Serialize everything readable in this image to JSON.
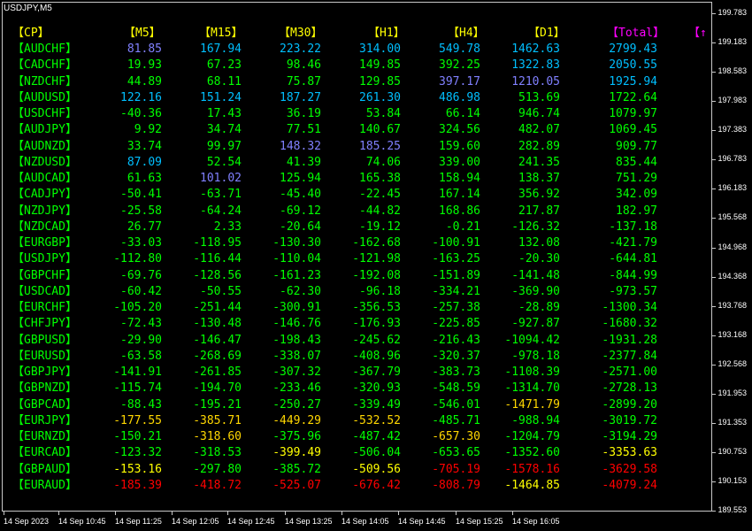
{
  "symbol_label": "USDJPY,M5",
  "headers": {
    "cp": "【CP】",
    "m5": "【M5】",
    "m15": "【M15】",
    "m30": "【M30】",
    "h1": "【H1】",
    "h4": "【H4】",
    "d1": "【D1】",
    "total": "【Total】",
    "extra": "【↑"
  },
  "colors": {
    "header": "#ffff00",
    "total_header": "#ff00ff",
    "pair": "#00ff00",
    "strong_positive": "#00bfff",
    "positive": "#00ff00",
    "neutral_purple": "#8080ff",
    "negative": "#00ff00",
    "warn": "#ffff00",
    "warn_orange": "#ffd700",
    "strong_negative": "#ff0000"
  },
  "rows": [
    {
      "pair": "【AUDCHF】",
      "m5": "81.85",
      "m15": "167.94",
      "m30": "223.22",
      "h1": "314.00",
      "h4": "549.78",
      "d1": "1462.63",
      "total": "2799.43",
      "c": [
        "#8080ff",
        "#00bfff",
        "#00bfff",
        "#00bfff",
        "#00bfff",
        "#00bfff",
        "#00bfff"
      ]
    },
    {
      "pair": "【CADCHF】",
      "m5": "19.93",
      "m15": "67.23",
      "m30": "98.46",
      "h1": "149.85",
      "h4": "392.25",
      "d1": "1322.83",
      "total": "2050.55",
      "c": [
        "#00ff00",
        "#00ff00",
        "#00ff00",
        "#00ff00",
        "#00ff00",
        "#00bfff",
        "#00bfff"
      ]
    },
    {
      "pair": "【NZDCHF】",
      "m5": "44.89",
      "m15": "68.11",
      "m30": "75.87",
      "h1": "129.85",
      "h4": "397.17",
      "d1": "1210.05",
      "total": "1925.94",
      "c": [
        "#00ff00",
        "#00ff00",
        "#00ff00",
        "#00ff00",
        "#8080ff",
        "#8080ff",
        "#00bfff"
      ]
    },
    {
      "pair": "【AUDUSD】",
      "m5": "122.16",
      "m15": "151.24",
      "m30": "187.27",
      "h1": "261.30",
      "h4": "486.98",
      "d1": "513.69",
      "total": "1722.64",
      "c": [
        "#00bfff",
        "#00bfff",
        "#00bfff",
        "#00bfff",
        "#00bfff",
        "#00ff00",
        "#00ff00"
      ]
    },
    {
      "pair": "【USDCHF】",
      "m5": "-40.36",
      "m15": "17.43",
      "m30": "36.19",
      "h1": "53.84",
      "h4": "66.14",
      "d1": "946.74",
      "total": "1079.97",
      "c": [
        "#00ff00",
        "#00ff00",
        "#00ff00",
        "#00ff00",
        "#00ff00",
        "#00ff00",
        "#00ff00"
      ]
    },
    {
      "pair": "【AUDJPY】",
      "m5": "9.92",
      "m15": "34.74",
      "m30": "77.51",
      "h1": "140.67",
      "h4": "324.56",
      "d1": "482.07",
      "total": "1069.45",
      "c": [
        "#00ff00",
        "#00ff00",
        "#00ff00",
        "#00ff00",
        "#00ff00",
        "#00ff00",
        "#00ff00"
      ]
    },
    {
      "pair": "【AUDNZD】",
      "m5": "33.74",
      "m15": "99.97",
      "m30": "148.32",
      "h1": "185.25",
      "h4": "159.60",
      "d1": "282.89",
      "total": "909.77",
      "c": [
        "#00ff00",
        "#00ff00",
        "#8080ff",
        "#8080ff",
        "#00ff00",
        "#00ff00",
        "#00ff00"
      ]
    },
    {
      "pair": "【NZDUSD】",
      "m5": "87.09",
      "m15": "52.54",
      "m30": "41.39",
      "h1": "74.06",
      "h4": "339.00",
      "d1": "241.35",
      "total": "835.44",
      "c": [
        "#00bfff",
        "#00ff00",
        "#00ff00",
        "#00ff00",
        "#00ff00",
        "#00ff00",
        "#00ff00"
      ]
    },
    {
      "pair": "【AUDCAD】",
      "m5": "61.63",
      "m15": "101.02",
      "m30": "125.94",
      "h1": "165.38",
      "h4": "158.94",
      "d1": "138.37",
      "total": "751.29",
      "c": [
        "#00ff00",
        "#8080ff",
        "#00ff00",
        "#00ff00",
        "#00ff00",
        "#00ff00",
        "#00ff00"
      ]
    },
    {
      "pair": "【CADJPY】",
      "m5": "-50.41",
      "m15": "-63.71",
      "m30": "-45.40",
      "h1": "-22.45",
      "h4": "167.14",
      "d1": "356.92",
      "total": "342.09",
      "c": [
        "#00ff00",
        "#00ff00",
        "#00ff00",
        "#00ff00",
        "#00ff00",
        "#00ff00",
        "#00ff00"
      ]
    },
    {
      "pair": "【NZDJPY】",
      "m5": "-25.58",
      "m15": "-64.24",
      "m30": "-69.12",
      "h1": "-44.82",
      "h4": "168.86",
      "d1": "217.87",
      "total": "182.97",
      "c": [
        "#00ff00",
        "#00ff00",
        "#00ff00",
        "#00ff00",
        "#00ff00",
        "#00ff00",
        "#00ff00"
      ]
    },
    {
      "pair": "【NZDCAD】",
      "m5": "26.77",
      "m15": "2.33",
      "m30": "-20.64",
      "h1": "-19.12",
      "h4": "-0.21",
      "d1": "-126.32",
      "total": "-137.18",
      "c": [
        "#00ff00",
        "#00ff00",
        "#00ff00",
        "#00ff00",
        "#00ff00",
        "#00ff00",
        "#00ff00"
      ]
    },
    {
      "pair": "【EURGBP】",
      "m5": "-33.03",
      "m15": "-118.95",
      "m30": "-130.30",
      "h1": "-162.68",
      "h4": "-100.91",
      "d1": "132.08",
      "total": "-421.79",
      "c": [
        "#00ff00",
        "#00ff00",
        "#00ff00",
        "#00ff00",
        "#00ff00",
        "#00ff00",
        "#00ff00"
      ]
    },
    {
      "pair": "【USDJPY】",
      "m5": "-112.80",
      "m15": "-116.44",
      "m30": "-110.04",
      "h1": "-121.98",
      "h4": "-163.25",
      "d1": "-20.30",
      "total": "-644.81",
      "c": [
        "#00ff00",
        "#00ff00",
        "#00ff00",
        "#00ff00",
        "#00ff00",
        "#00ff00",
        "#00ff00"
      ]
    },
    {
      "pair": "【GBPCHF】",
      "m5": "-69.76",
      "m15": "-128.56",
      "m30": "-161.23",
      "h1": "-192.08",
      "h4": "-151.89",
      "d1": "-141.48",
      "total": "-844.99",
      "c": [
        "#00ff00",
        "#00ff00",
        "#00ff00",
        "#00ff00",
        "#00ff00",
        "#00ff00",
        "#00ff00"
      ]
    },
    {
      "pair": "【USDCAD】",
      "m5": "-60.42",
      "m15": "-50.55",
      "m30": "-62.30",
      "h1": "-96.18",
      "h4": "-334.21",
      "d1": "-369.90",
      "total": "-973.57",
      "c": [
        "#00ff00",
        "#00ff00",
        "#00ff00",
        "#00ff00",
        "#00ff00",
        "#00ff00",
        "#00ff00"
      ]
    },
    {
      "pair": "【EURCHF】",
      "m5": "-105.20",
      "m15": "-251.44",
      "m30": "-300.91",
      "h1": "-356.53",
      "h4": "-257.38",
      "d1": "-28.89",
      "total": "-1300.34",
      "c": [
        "#00ff00",
        "#00ff00",
        "#00ff00",
        "#00ff00",
        "#00ff00",
        "#00ff00",
        "#00ff00"
      ]
    },
    {
      "pair": "【CHFJPY】",
      "m5": "-72.43",
      "m15": "-130.48",
      "m30": "-146.76",
      "h1": "-176.93",
      "h4": "-225.85",
      "d1": "-927.87",
      "total": "-1680.32",
      "c": [
        "#00ff00",
        "#00ff00",
        "#00ff00",
        "#00ff00",
        "#00ff00",
        "#00ff00",
        "#00ff00"
      ]
    },
    {
      "pair": "【GBPUSD】",
      "m5": "-29.90",
      "m15": "-146.47",
      "m30": "-198.43",
      "h1": "-245.62",
      "h4": "-216.43",
      "d1": "-1094.42",
      "total": "-1931.28",
      "c": [
        "#00ff00",
        "#00ff00",
        "#00ff00",
        "#00ff00",
        "#00ff00",
        "#00ff00",
        "#00ff00"
      ]
    },
    {
      "pair": "【EURUSD】",
      "m5": "-63.58",
      "m15": "-268.69",
      "m30": "-338.07",
      "h1": "-408.96",
      "h4": "-320.37",
      "d1": "-978.18",
      "total": "-2377.84",
      "c": [
        "#00ff00",
        "#00ff00",
        "#00ff00",
        "#00ff00",
        "#00ff00",
        "#00ff00",
        "#00ff00"
      ]
    },
    {
      "pair": "【GBPJPY】",
      "m5": "-141.91",
      "m15": "-261.85",
      "m30": "-307.32",
      "h1": "-367.79",
      "h4": "-383.73",
      "d1": "-1108.39",
      "total": "-2571.00",
      "c": [
        "#00ff00",
        "#00ff00",
        "#00ff00",
        "#00ff00",
        "#00ff00",
        "#00ff00",
        "#00ff00"
      ]
    },
    {
      "pair": "【GBPNZD】",
      "m5": "-115.74",
      "m15": "-194.70",
      "m30": "-233.46",
      "h1": "-320.93",
      "h4": "-548.59",
      "d1": "-1314.70",
      "total": "-2728.13",
      "c": [
        "#00ff00",
        "#00ff00",
        "#00ff00",
        "#00ff00",
        "#00ff00",
        "#00ff00",
        "#00ff00"
      ]
    },
    {
      "pair": "【GBPCAD】",
      "m5": "-88.43",
      "m15": "-195.21",
      "m30": "-250.27",
      "h1": "-339.49",
      "h4": "-546.01",
      "d1": "-1471.79",
      "total": "-2899.20",
      "c": [
        "#00ff00",
        "#00ff00",
        "#00ff00",
        "#00ff00",
        "#00ff00",
        "#ffd700",
        "#00ff00"
      ]
    },
    {
      "pair": "【EURJPY】",
      "m5": "-177.55",
      "m15": "-385.71",
      "m30": "-449.29",
      "h1": "-532.52",
      "h4": "-485.71",
      "d1": "-988.94",
      "total": "-3019.72",
      "c": [
        "#ffd700",
        "#ffd700",
        "#ffd700",
        "#ffd700",
        "#00ff00",
        "#00ff00",
        "#00ff00"
      ]
    },
    {
      "pair": "【EURNZD】",
      "m5": "-150.21",
      "m15": "-318.60",
      "m30": "-375.96",
      "h1": "-487.42",
      "h4": "-657.30",
      "d1": "-1204.79",
      "total": "-3194.29",
      "c": [
        "#00ff00",
        "#ffd700",
        "#00ff00",
        "#00ff00",
        "#ffd700",
        "#00ff00",
        "#00ff00"
      ]
    },
    {
      "pair": "【EURCAD】",
      "m5": "-123.32",
      "m15": "-318.53",
      "m30": "-399.49",
      "h1": "-506.04",
      "h4": "-653.65",
      "d1": "-1352.60",
      "total": "-3353.63",
      "c": [
        "#00ff00",
        "#00ff00",
        "#ffff00",
        "#00ff00",
        "#00ff00",
        "#00ff00",
        "#ffff00"
      ]
    },
    {
      "pair": "【GBPAUD】",
      "m5": "-153.16",
      "m15": "-297.80",
      "m30": "-385.72",
      "h1": "-509.56",
      "h4": "-705.19",
      "d1": "-1578.16",
      "total": "-3629.58",
      "c": [
        "#ffff00",
        "#00ff00",
        "#00ff00",
        "#ffff00",
        "#ff0000",
        "#ff0000",
        "#ff0000"
      ]
    },
    {
      "pair": "【EURAUD】",
      "m5": "-185.39",
      "m15": "-418.72",
      "m30": "-525.07",
      "h1": "-676.42",
      "h4": "-808.79",
      "d1": "-1464.85",
      "total": "-4079.24",
      "c": [
        "#ff0000",
        "#ff0000",
        "#ff0000",
        "#ff0000",
        "#ff0000",
        "#ffff00",
        "#ff0000"
      ]
    }
  ],
  "price_axis": [
    "199.783",
    "199.183",
    "198.583",
    "197.983",
    "197.383",
    "196.783",
    "196.183",
    "195.568",
    "194.968",
    "194.368",
    "193.768",
    "193.168",
    "192.568",
    "191.953",
    "191.353",
    "190.753",
    "190.153",
    "189.553"
  ],
  "time_axis": [
    "14 Sep 2023",
    "14 Sep 10:45",
    "14 Sep 11:25",
    "14 Sep 12:05",
    "14 Sep 12:45",
    "14 Sep 13:25",
    "14 Sep 14:05",
    "14 Sep 14:45",
    "14 Sep 15:25",
    "14 Sep 16:05"
  ]
}
